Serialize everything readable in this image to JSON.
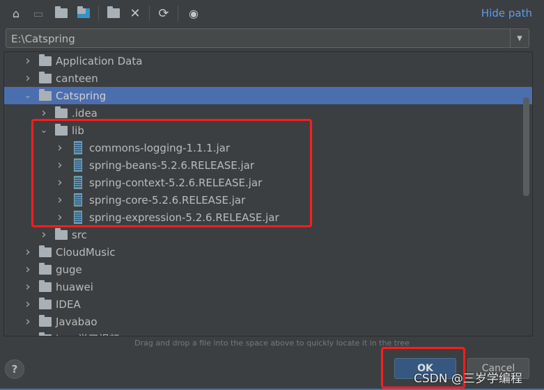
{
  "toolbar": {
    "icons": [
      "home-icon",
      "desktop-icon",
      "project-folder-icon",
      "module-folder-icon",
      "new-folder-icon",
      "delete-icon",
      "refresh-icon",
      "show-hidden-icon"
    ],
    "hide_path": "Hide path"
  },
  "path": {
    "value": "E:\\Catspring"
  },
  "tree": [
    {
      "label": "Application Data",
      "level": 0,
      "type": "folder",
      "expanded": false
    },
    {
      "label": "canteen",
      "level": 0,
      "type": "folder",
      "expanded": false
    },
    {
      "label": "Catspring",
      "level": 0,
      "type": "folder",
      "expanded": true,
      "selected": true
    },
    {
      "label": ".idea",
      "level": 1,
      "type": "folder",
      "expanded": false
    },
    {
      "label": "lib",
      "level": 1,
      "type": "folder",
      "expanded": true
    },
    {
      "label": "commons-logging-1.1.1.jar",
      "level": 2,
      "type": "jar",
      "expanded": false
    },
    {
      "label": "spring-beans-5.2.6.RELEASE.jar",
      "level": 2,
      "type": "jar",
      "expanded": false
    },
    {
      "label": "spring-context-5.2.6.RELEASE.jar",
      "level": 2,
      "type": "jar",
      "expanded": false
    },
    {
      "label": "spring-core-5.2.6.RELEASE.jar",
      "level": 2,
      "type": "jar",
      "expanded": false
    },
    {
      "label": "spring-expression-5.2.6.RELEASE.jar",
      "level": 2,
      "type": "jar",
      "expanded": false
    },
    {
      "label": "src",
      "level": 1,
      "type": "folder",
      "expanded": false
    },
    {
      "label": "CloudMusic",
      "level": 0,
      "type": "folder",
      "expanded": false
    },
    {
      "label": "guge",
      "level": 0,
      "type": "folder",
      "expanded": false
    },
    {
      "label": "huawei",
      "level": 0,
      "type": "folder",
      "expanded": false
    },
    {
      "label": "IDEA",
      "level": 0,
      "type": "folder",
      "expanded": false
    },
    {
      "label": "Javabao",
      "level": 0,
      "type": "folder",
      "expanded": false
    },
    {
      "label": "java学习视频",
      "level": 0,
      "type": "folder",
      "expanded": false
    }
  ],
  "hint": "Drag and drop a file into the space above to quickly locate it in the tree",
  "buttons": {
    "help": "?",
    "ok": "OK",
    "cancel": "Cancel"
  },
  "watermark": "CSDN @三岁学编程",
  "colors": {
    "selection": "#4b6eaf",
    "highlight_box": "#ff1c1c",
    "link": "#589df6"
  }
}
